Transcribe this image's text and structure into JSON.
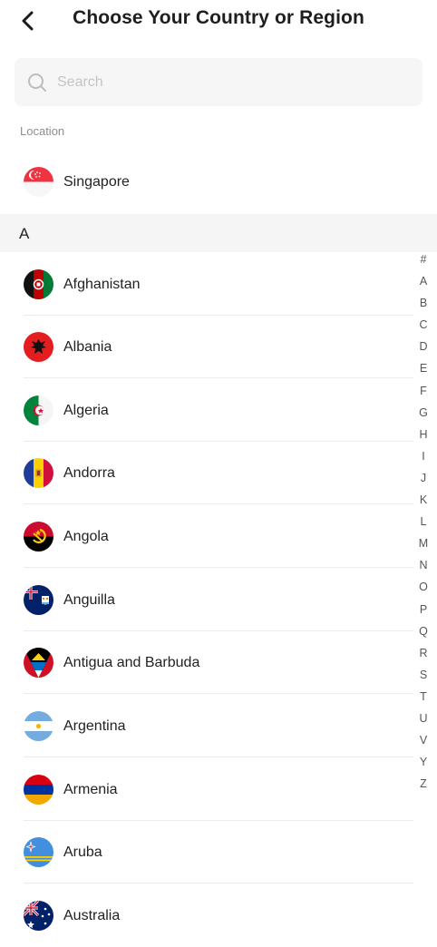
{
  "header": {
    "title": "Choose Your Country or Region"
  },
  "search": {
    "placeholder": "Search",
    "value": ""
  },
  "location": {
    "label": "Location",
    "country": {
      "name": "Singapore",
      "flag_icon": "singapore-flag-icon"
    }
  },
  "section": {
    "letter": "A"
  },
  "countries": [
    {
      "name": "Afghanistan",
      "flag_icon": "afghanistan-flag-icon"
    },
    {
      "name": "Albania",
      "flag_icon": "albania-flag-icon"
    },
    {
      "name": "Algeria",
      "flag_icon": "algeria-flag-icon"
    },
    {
      "name": "Andorra",
      "flag_icon": "andorra-flag-icon"
    },
    {
      "name": "Angola",
      "flag_icon": "angola-flag-icon"
    },
    {
      "name": "Anguilla",
      "flag_icon": "anguilla-flag-icon"
    },
    {
      "name": "Antigua and Barbuda",
      "flag_icon": "antigua-and-barbuda-flag-icon"
    },
    {
      "name": "Argentina",
      "flag_icon": "argentina-flag-icon"
    },
    {
      "name": "Armenia",
      "flag_icon": "armenia-flag-icon"
    },
    {
      "name": "Aruba",
      "flag_icon": "aruba-flag-icon"
    },
    {
      "name": "Australia",
      "flag_icon": "australia-flag-icon"
    }
  ],
  "index": [
    "#",
    "A",
    "B",
    "C",
    "D",
    "E",
    "F",
    "G",
    "H",
    "I",
    "J",
    "K",
    "L",
    "M",
    "N",
    "O",
    "P",
    "Q",
    "R",
    "S",
    "T",
    "U",
    "V",
    "Y",
    "Z"
  ],
  "colors": {
    "search_bg": "#f6f6f6",
    "section_bg": "#f5f5f5",
    "divider": "#ececec"
  }
}
